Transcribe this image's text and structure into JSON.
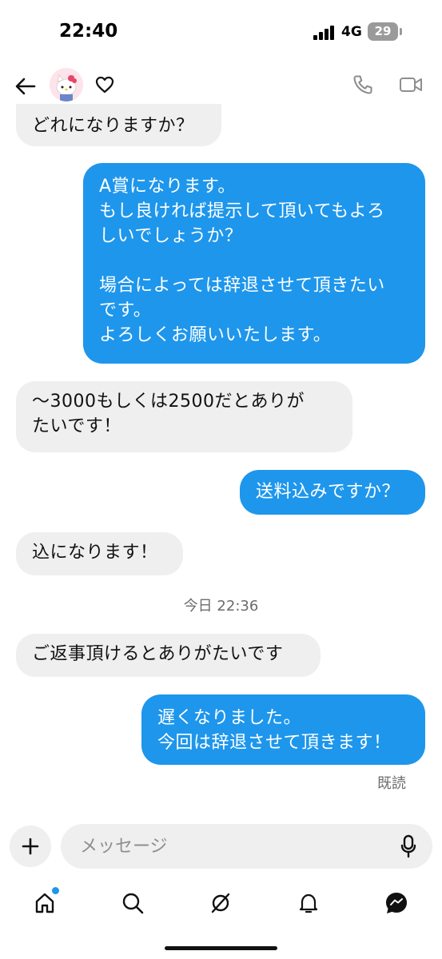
{
  "status_bar": {
    "time": "22:40",
    "network": "4G",
    "battery": "29"
  },
  "header": {
    "avatar": "hello-kitty-avatar"
  },
  "messages": [
    {
      "side": "in",
      "text": "どれになりますか？"
    },
    {
      "side": "out",
      "text": "A賞になります。\nもし良ければ提示して頂いてもよろ\nしいでしょうか？\n\n場合によっては辞退させて頂きたい\nです。\nよろしくお願いいたします。"
    },
    {
      "side": "in",
      "text": "〜3000もしくは2500だとありが\nたいです！"
    },
    {
      "side": "out",
      "text": "送料込みですか？"
    },
    {
      "side": "in",
      "text": "込になります！"
    },
    {
      "side": "in",
      "text": "ご返事頂けるとありがたいです"
    },
    {
      "side": "out",
      "text": "遅くなりました。\n今回は辞退させて頂きます！"
    }
  ],
  "timestamp": "今日 22:36",
  "read_receipt": "既読",
  "composer": {
    "placeholder": "メッセージ"
  },
  "colors": {
    "accent": "#1e96ec",
    "incoming_bubble": "#efefef"
  },
  "icons": {
    "header": [
      "back-arrow-icon",
      "heart-icon",
      "phone-icon",
      "video-camera-icon"
    ],
    "composer": [
      "plus-icon",
      "microphone-icon"
    ],
    "nav": [
      "home-icon",
      "search-icon",
      "explore-icon",
      "bell-icon",
      "messages-icon"
    ]
  }
}
